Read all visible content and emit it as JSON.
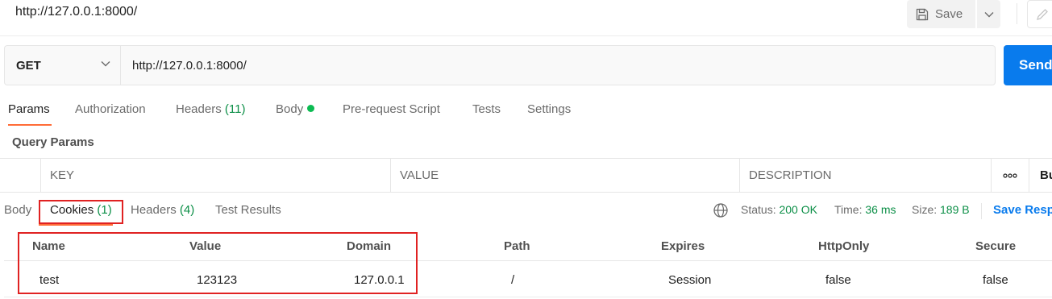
{
  "request": {
    "title": "http://127.0.0.1:8000/",
    "method": "GET",
    "url": "http://127.0.0.1:8000/",
    "save_label": "Save",
    "send_label": "Send"
  },
  "request_tabs": [
    {
      "label": "Params",
      "active": true
    },
    {
      "label": "Authorization"
    },
    {
      "label": "Headers",
      "count": "(11)"
    },
    {
      "label": "Body"
    },
    {
      "label": "Pre-request Script"
    },
    {
      "label": "Tests"
    },
    {
      "label": "Settings"
    }
  ],
  "query_params": {
    "title": "Query Params",
    "columns": [
      "KEY",
      "VALUE",
      "DESCRIPTION"
    ],
    "more_icon": "ooo",
    "bulk_edit_label": "Bu"
  },
  "response_tabs": [
    {
      "label": "Body"
    },
    {
      "label": "Cookies",
      "count": "(1)",
      "active": true
    },
    {
      "label": "Headers",
      "count": "(4)"
    },
    {
      "label": "Test Results"
    }
  ],
  "response_status": {
    "status_label": "Status:",
    "status_value": "200 OK",
    "time_label": "Time:",
    "time_value": "36 ms",
    "size_label": "Size:",
    "size_value": "189 B",
    "save_response_label": "Save Resp"
  },
  "cookies": {
    "columns": [
      "Name",
      "Value",
      "Domain",
      "Path",
      "Expires",
      "HttpOnly",
      "Secure"
    ],
    "rows": [
      [
        "test",
        "123123",
        "127.0.0.1",
        "/",
        "Session",
        "false",
        "false"
      ]
    ]
  },
  "colors": {
    "accent_orange": "#ff6c37",
    "send_blue": "#097bed",
    "success_green": "#0c8f47",
    "annotation_red": "#e02222"
  }
}
